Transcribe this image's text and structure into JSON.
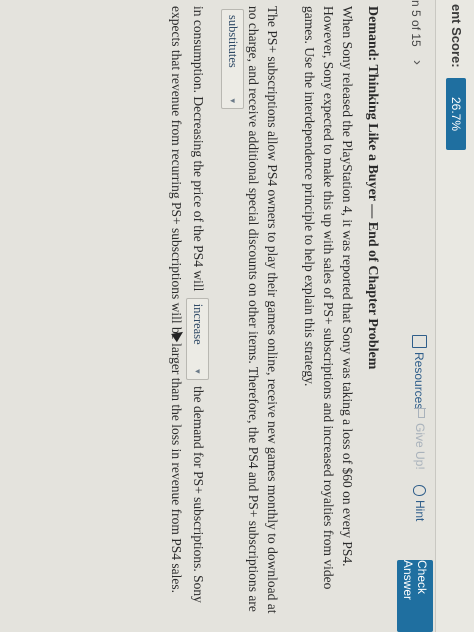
{
  "header": {
    "score_label": "ent Score:",
    "score_value": "26.7%"
  },
  "nav": {
    "question_count": "n 5 of 15",
    "next_chevron": "›"
  },
  "toolbar": {
    "resources_label": "Resources",
    "giveup_label": "Give Up!",
    "hint_label": "Hint",
    "check_answer_label": "Check Answer"
  },
  "problem": {
    "title": "Demand: Thinking Like a Buyer — End of Chapter Problem",
    "intro": "When Sony released the PlayStation 4, it was reported that Sony was taking a loss of $60 on every PS4. However, Sony expected to make this up with sales of PS+ subscriptions and increased royalties from video games. Use the interdependence principle to help explain this strategy.",
    "p2_part1": "The PS+ subscriptions allow PS4 owners to play their games online, receive new games monthly to download at no charge, and receive additional special discounts on other items. Therefore, the PS4 and PS+ subscriptions are",
    "dropdown1_value": "substitutes",
    "p2_part2": "in consumption. Decreasing the price of the PS4 will",
    "dropdown2_value": "increase",
    "p2_part3": "the demand for PS+ subscriptions. Sony expects that revenue from recurring PS+ subscriptions will be larger than the loss in revenue from PS4 sales."
  },
  "icons": {
    "resources": "document-icon",
    "giveup": "flag-icon",
    "hint": "lightbulb-icon",
    "dropdown": "chevron-down-icon"
  },
  "colors": {
    "accent": "#1f6fa0",
    "link": "#2f5e8a",
    "disabled": "#a9b2bb"
  }
}
